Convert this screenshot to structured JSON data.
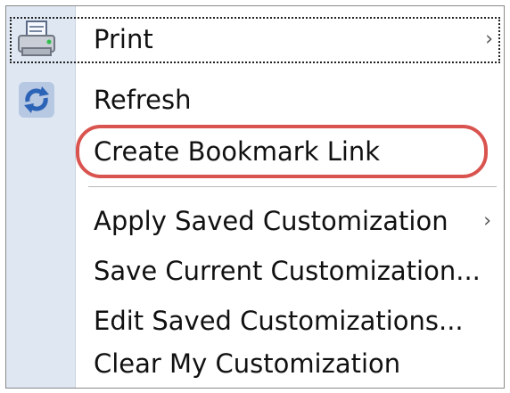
{
  "menu": {
    "items": [
      {
        "label": "Print",
        "icon": "printer-icon",
        "submenu": true,
        "focused": true
      },
      {
        "label": "Refresh",
        "icon": "refresh-icon",
        "submenu": false
      },
      {
        "label": "Create Bookmark Link",
        "icon": "",
        "submenu": false,
        "highlighted": true
      },
      {
        "label": "Apply Saved Customization",
        "icon": "",
        "submenu": true
      },
      {
        "label": "Save Current Customization...",
        "icon": "",
        "submenu": false
      },
      {
        "label": "Edit Saved Customizations...",
        "icon": "",
        "submenu": false
      },
      {
        "label": "Clear My Customization",
        "icon": "",
        "submenu": false
      }
    ],
    "submenu_glyph": "›"
  },
  "colors": {
    "gutter": "#dfe7f2",
    "highlight": "#d9534f",
    "text": "#111111"
  }
}
